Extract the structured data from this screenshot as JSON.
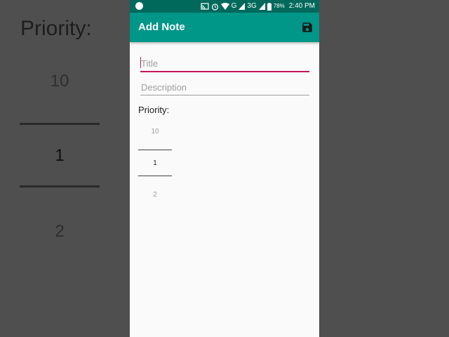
{
  "status_bar": {
    "battery": "78%",
    "time": "2:40 PM",
    "network": "3G",
    "carrier_letter": "G",
    "icons": [
      "cast-icon",
      "alarm-icon",
      "wifi-icon",
      "signal-icon",
      "battery-icon"
    ]
  },
  "app_bar": {
    "title": "Add Note",
    "save_icon": "save-icon",
    "color": "#009688",
    "status_color": "#00695c"
  },
  "form": {
    "title_placeholder": "Title",
    "title_value": "",
    "description_placeholder": "Description",
    "description_value": "",
    "accent_color": "#c2185b"
  },
  "priority": {
    "label": "Priority:",
    "values": [
      "10",
      "1",
      "2"
    ],
    "selected": "1"
  },
  "background_copy": {
    "label": "Priority:",
    "values": [
      "10",
      "1",
      "2"
    ]
  }
}
